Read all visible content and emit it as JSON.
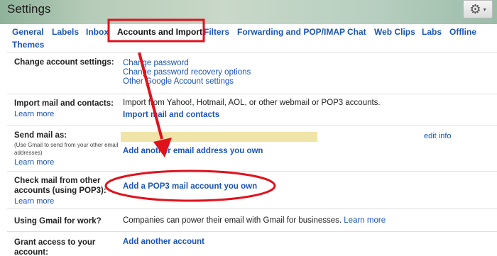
{
  "header": {
    "title": "Settings",
    "gear_icon": "gear-icon",
    "gear_caret": "chevron-down-icon",
    "gear_glyph": "⚙",
    "caret_glyph": "▾"
  },
  "tabs": [
    {
      "label": "General"
    },
    {
      "label": "Labels"
    },
    {
      "label": "Inbox"
    },
    {
      "label": "Accounts and Import"
    },
    {
      "label": "Filters"
    },
    {
      "label": "Forwarding and POP/IMAP"
    },
    {
      "label": "Chat"
    },
    {
      "label": "Web Clips"
    },
    {
      "label": "Labs"
    },
    {
      "label": "Offline"
    },
    {
      "label": "Themes"
    }
  ],
  "rows": {
    "change_account": {
      "label": "Change account settings:",
      "links": [
        "Change password",
        "Change password recovery options",
        "Other Google Account settings"
      ]
    },
    "import": {
      "label": "Import mail and contacts:",
      "learn_more": "Learn more",
      "text": "Import from Yahoo!, Hotmail, AOL, or other webmail or POP3 accounts.",
      "action": "Import mail and contacts"
    },
    "send_as": {
      "label": "Send mail as:",
      "sub": "(Use Gmail to send from your other email addresses)",
      "learn_more": "Learn more",
      "edit": "edit info",
      "action": "Add another email address you own"
    },
    "check_mail": {
      "label": "Check mail from other accounts (using POP3):",
      "learn_more": "Learn more",
      "action": "Add a POP3 mail account you own"
    },
    "work": {
      "label": "Using Gmail for work?",
      "text": "Companies can power their email with Gmail for businesses.",
      "learn_more": "Learn more"
    },
    "grant": {
      "label": "Grant access to your account:",
      "action": "Add another account"
    }
  },
  "colors": {
    "link": "#1a55b5",
    "annotation": "#e0121c",
    "redaction": "#f0e4a8"
  }
}
